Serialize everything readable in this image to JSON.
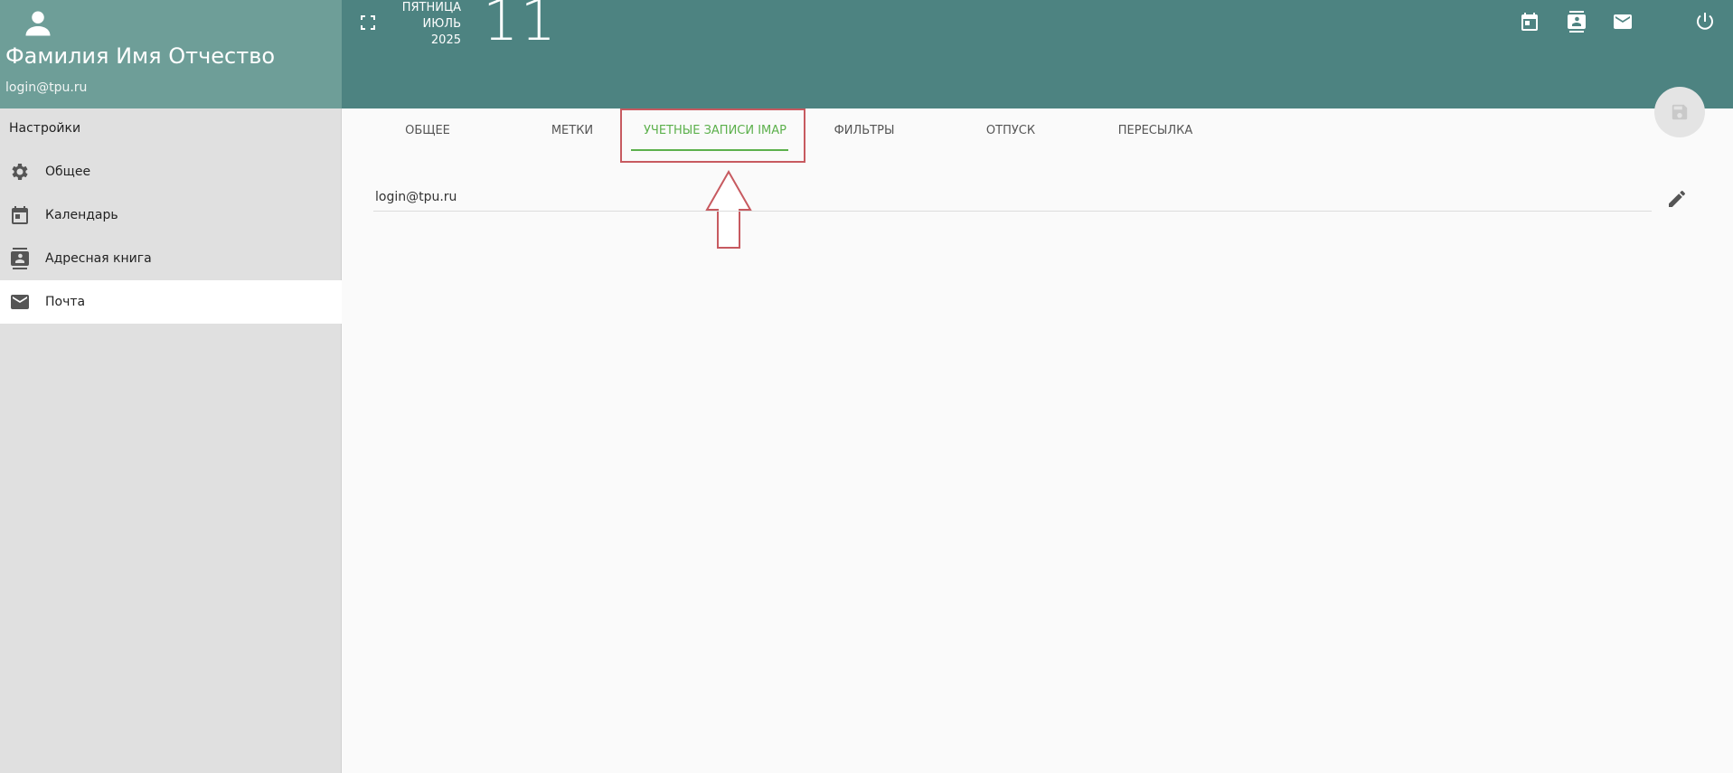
{
  "user": {
    "name": "Фамилия Имя Отчество",
    "login": "login@tpu.ru"
  },
  "sidebar": {
    "section_title": "Настройки",
    "items": [
      {
        "label": "Общее",
        "icon": "gear-icon"
      },
      {
        "label": "Календарь",
        "icon": "calendar-icon"
      },
      {
        "label": "Адресная книга",
        "icon": "contacts-icon"
      },
      {
        "label": "Почта",
        "icon": "mail-icon",
        "active": true
      }
    ]
  },
  "header": {
    "weekday": "ПЯТНИЦА",
    "month": "ИЮЛЬ",
    "year": "2025",
    "day": "11"
  },
  "tabs": [
    {
      "label": "ОБЩЕЕ"
    },
    {
      "label": "МЕТКИ"
    },
    {
      "label": "УЧЕТНЫЕ ЗАПИСИ IMAP",
      "active": true
    },
    {
      "label": "ФИЛЬТРЫ"
    },
    {
      "label": "ОТПУСК"
    },
    {
      "label": "ПЕРЕСЫЛКА"
    }
  ],
  "accounts": [
    {
      "login": "login@tpu.ru"
    }
  ],
  "colors": {
    "sidebar_header": "#6e9e98",
    "topbar": "#4d8381",
    "active_tab": "#5cb04c",
    "highlight": "#c75a60"
  }
}
